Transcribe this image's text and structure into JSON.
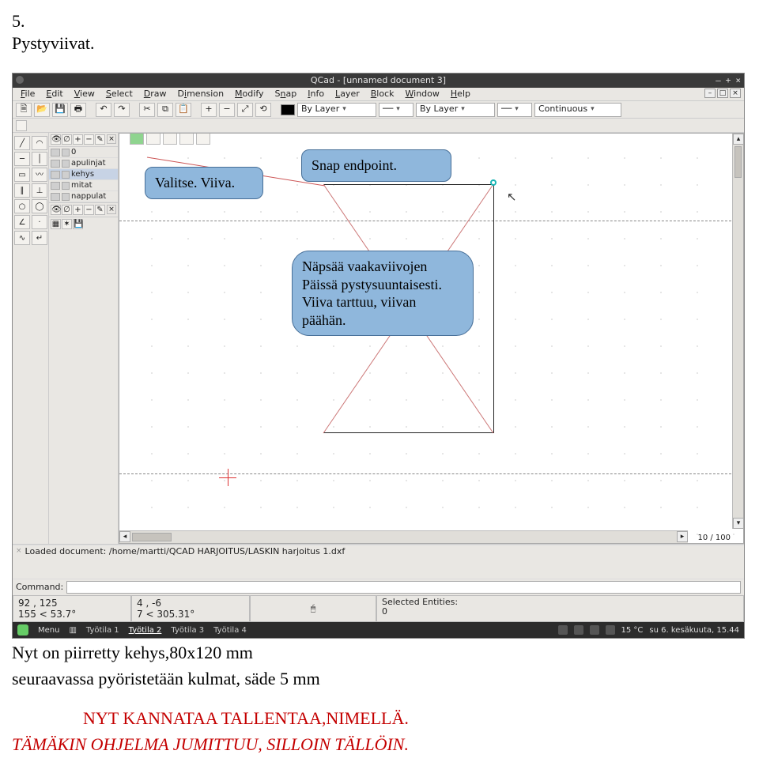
{
  "doc": {
    "section_number": "5.",
    "section_title": "Pystyviivat.",
    "below_line1": "Nyt on piirretty kehys,80x120 mm",
    "below_line2": "seuraavassa pyöristetään kulmat, säde 5 mm",
    "red_line1": "NYT KANNATAA TALLENTAA,NIMELLÄ.",
    "red_line2": "TÄMÄKIN OHJELMA JUMITTUU, SILLOIN TÄLLÖIN."
  },
  "callouts": {
    "a": "Valitse. Viiva.",
    "b": "Snap endpoint.",
    "c": "Näpsää vaakaviivojen Päissä pystysuuntaisesti. Viiva tarttuu, viivan päähän."
  },
  "window": {
    "title": "QCad - [unnamed document 3]"
  },
  "menus": [
    "File",
    "Edit",
    "View",
    "Select",
    "Draw",
    "Dimension",
    "Modify",
    "Snap",
    "Info",
    "Layer",
    "Block",
    "Window",
    "Help"
  ],
  "toolbar": {
    "lineweight": "By Layer",
    "linetype_mode": "By Layer",
    "linetype": "Continuous"
  },
  "layers": [
    {
      "name": "0",
      "sel": false
    },
    {
      "name": "apulinjat",
      "sel": false
    },
    {
      "name": "kehys",
      "sel": true
    },
    {
      "name": "mitat",
      "sel": false
    },
    {
      "name": "nappulat",
      "sel": false
    }
  ],
  "canvas": {
    "zoom": "10 / 100"
  },
  "status": {
    "loaded": "Loaded document: /home/martti/QCAD HARJOITUS/LASKIN harjoitus 1.dxf",
    "command_label": "Command:",
    "abs_xy": "92 , 125",
    "abs_polar": "155 < 53.7°",
    "rel_xy": "4 , -6",
    "rel_polar": "7 < 305.31°",
    "selected_label": "Selected Entities:",
    "selected_count": "0"
  },
  "taskbar": {
    "menu": "Menu",
    "workspaces": [
      "Työtila 1",
      "Työtila 2",
      "Työtila 3",
      "Työtila 4"
    ],
    "active_ws": 1,
    "temp": "15 °C",
    "clock": "su  6. kesäkuuta, 15.44"
  }
}
